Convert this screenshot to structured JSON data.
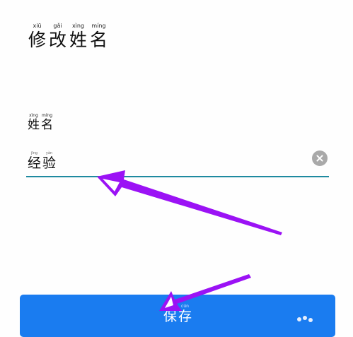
{
  "header": {
    "title": [
      {
        "pinyin": "xiū",
        "hanzi": "修"
      },
      {
        "pinyin": "gǎi",
        "hanzi": "改"
      },
      {
        "pinyin": "xìng",
        "hanzi": "姓"
      },
      {
        "pinyin": "míng",
        "hanzi": "名"
      }
    ]
  },
  "form": {
    "field_label": [
      {
        "pinyin": "xìng",
        "hanzi": "姓"
      },
      {
        "pinyin": "míng",
        "hanzi": "名"
      }
    ],
    "field_value": [
      {
        "pinyin": "jīng",
        "hanzi": "经"
      },
      {
        "pinyin": "yàn",
        "hanzi": "验"
      }
    ],
    "clear_icon": "close-circle-icon",
    "underline_color": "#1f8aa0"
  },
  "footer": {
    "save_label": [
      {
        "pinyin": "bǎo",
        "hanzi": "保"
      },
      {
        "pinyin": "cún",
        "hanzi": "存"
      }
    ],
    "button_color": "#1a7cf0"
  },
  "annotation_color": "#9b12f5"
}
